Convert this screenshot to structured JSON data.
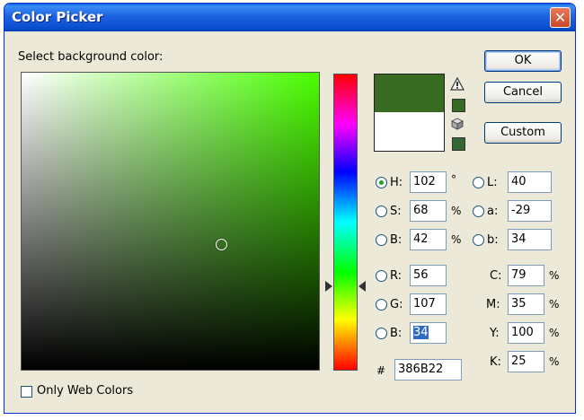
{
  "window": {
    "title": "Color Picker"
  },
  "prompt": "Select background color:",
  "buttons": {
    "ok": "OK",
    "cancel": "Cancel",
    "custom": "Custom"
  },
  "swatch": {
    "new_color": "#386b22",
    "current_color": "#ffffff"
  },
  "hsb": [
    {
      "key": "H:",
      "value": "102",
      "unit": "°",
      "selected": true
    },
    {
      "key": "S:",
      "value": "68",
      "unit": "%",
      "selected": false
    },
    {
      "key": "B:",
      "value": "42",
      "unit": "%",
      "selected": false
    }
  ],
  "lab": [
    {
      "key": "L:",
      "value": "40"
    },
    {
      "key": "a:",
      "value": "-29"
    },
    {
      "key": "b:",
      "value": "34"
    }
  ],
  "rgb": [
    {
      "key": "R:",
      "value": "56"
    },
    {
      "key": "G:",
      "value": "107"
    },
    {
      "key": "B:",
      "value": "34"
    }
  ],
  "cmyk": [
    {
      "key": "C:",
      "value": "79",
      "unit": "%"
    },
    {
      "key": "M:",
      "value": "35",
      "unit": "%"
    },
    {
      "key": "Y:",
      "value": "100",
      "unit": "%"
    },
    {
      "key": "K:",
      "value": "25",
      "unit": "%"
    }
  ],
  "hex": {
    "symbol": "#",
    "value": "386B22"
  },
  "web_only": {
    "label": "Only Web Colors",
    "checked": false
  },
  "colors": {
    "hue": "#49ff00"
  }
}
